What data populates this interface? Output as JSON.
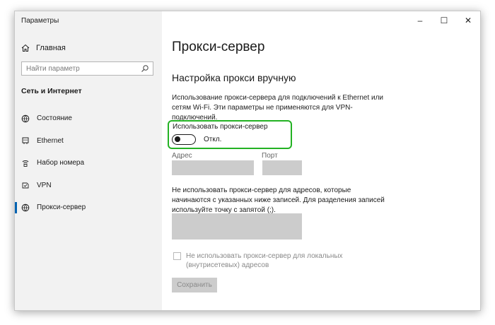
{
  "window": {
    "title": "Параметры",
    "controls": [
      "–",
      "☐",
      "✕"
    ]
  },
  "sidebar": {
    "home_label": "Главная",
    "search_placeholder": "Найти параметр",
    "section_title": "Сеть и Интернет",
    "items": [
      {
        "label": "Состояние",
        "icon": "globe-status-icon"
      },
      {
        "label": "Ethernet",
        "icon": "ethernet-icon"
      },
      {
        "label": "Набор номера",
        "icon": "dialup-icon"
      },
      {
        "label": "VPN",
        "icon": "vpn-icon"
      },
      {
        "label": "Прокси-сервер",
        "icon": "globe-icon",
        "active": true
      }
    ]
  },
  "main": {
    "page_title": "Прокси-сервер",
    "subtitle": "Настройка прокси вручную",
    "description": "Использование прокси-сервера для подключений к Ethernet или сетям Wi-Fi. Эти параметры не применяются для VPN-подключений.",
    "use_proxy_label": "Использовать прокси-сервер",
    "toggle_state": "Откл.",
    "toggle_on": false,
    "address_label": "Адрес",
    "address_value": "",
    "port_label": "Порт",
    "port_value": "",
    "exclusions_description": "Не использовать прокси-сервер для адресов, которые начинаются с указанных ниже записей. Для разделения записей используйте точку с запятой (;).",
    "exclusions_value": "",
    "local_checkbox_label": "Не использовать прокси-сервер для локальных (внутрисетевых) адресов",
    "local_checkbox_checked": false,
    "save_label": "Сохранить"
  },
  "colors": {
    "highlight": "#23b223",
    "sidebar_bg": "#f2f2f2",
    "disabled_field": "#cccccc",
    "accent": "#0063b1"
  }
}
